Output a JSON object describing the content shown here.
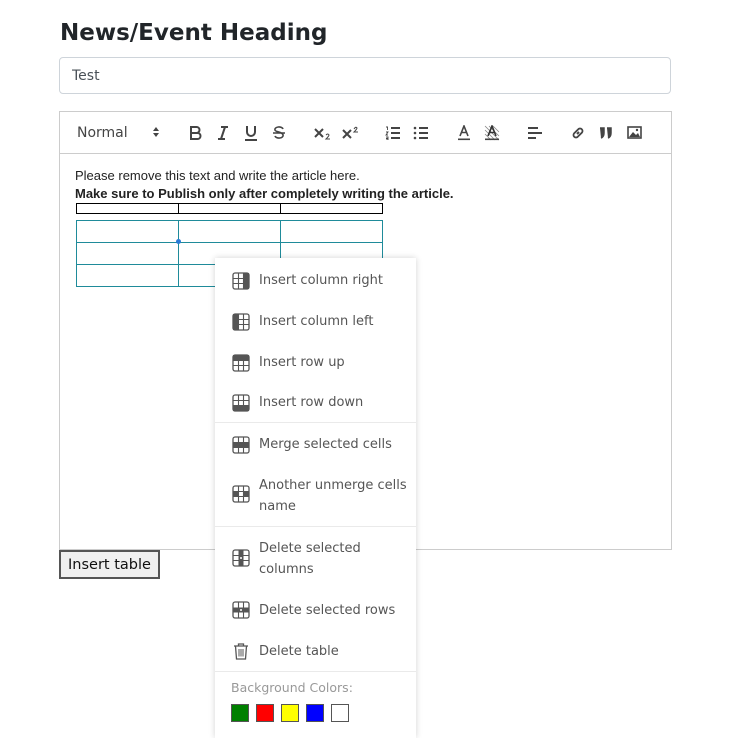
{
  "page": {
    "heading": "News/Event Heading"
  },
  "title_input": {
    "value": "Test"
  },
  "toolbar": {
    "format_label": "Normal",
    "buttons": [
      "bold-icon",
      "italic-icon",
      "underline-icon",
      "strikethrough-icon",
      "subscript-icon",
      "superscript-icon",
      "ordered-list-icon",
      "bullet-list-icon",
      "text-color-icon",
      "background-color-icon",
      "align-icon",
      "link-icon",
      "blockquote-icon",
      "image-icon"
    ]
  },
  "editor": {
    "line1": "Please remove this text and write the article here.",
    "line2": "Make sure to Publish only after completely writing the article."
  },
  "insert_table_label": "Insert table",
  "context_menu": {
    "items": [
      {
        "label": "Insert column right",
        "icon": "insert-column-right-icon"
      },
      {
        "label": "Insert column left",
        "icon": "insert-column-left-icon"
      },
      {
        "label": "Insert row up",
        "icon": "insert-row-up-icon"
      },
      {
        "label": "Insert row down",
        "icon": "insert-row-down-icon"
      },
      {
        "label": "Merge selected cells",
        "icon": "merge-cells-icon"
      },
      {
        "label": "Another unmerge cells name",
        "icon": "unmerge-cells-icon"
      },
      {
        "label": "Delete selected columns",
        "icon": "delete-columns-icon"
      },
      {
        "label": "Delete selected rows",
        "icon": "delete-rows-icon"
      },
      {
        "label": "Delete table",
        "icon": "trash-icon"
      }
    ],
    "background_label": "Background Colors:",
    "colors": [
      "#008000",
      "#ff0000",
      "#ffff00",
      "#0000ff",
      "#ffffff"
    ]
  }
}
